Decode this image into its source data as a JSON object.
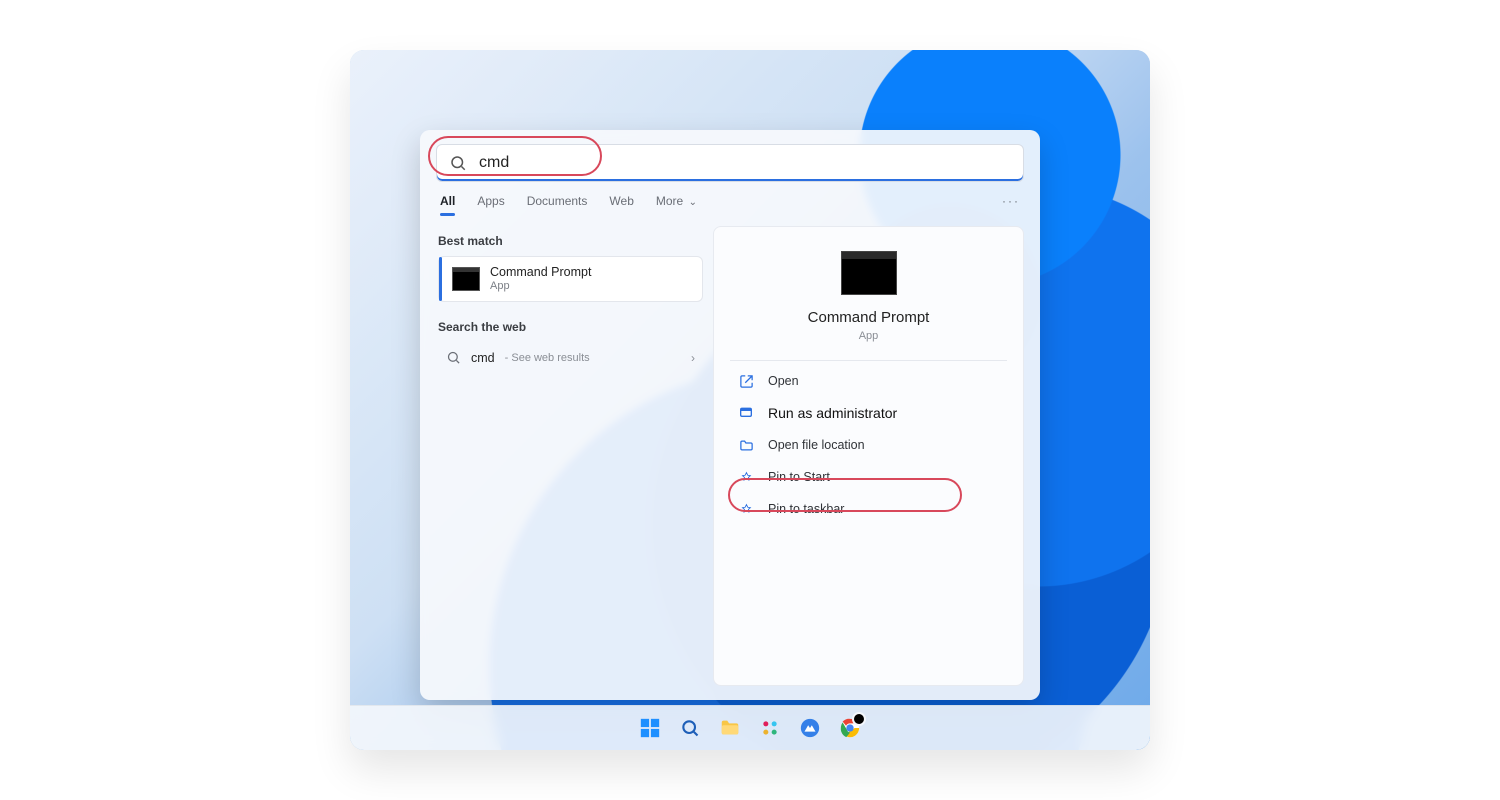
{
  "search": {
    "query": "cmd",
    "tabs": [
      "All",
      "Apps",
      "Documents",
      "Web",
      "More"
    ]
  },
  "left": {
    "best_match_heading": "Best match",
    "best_match": {
      "title": "Command Prompt",
      "subtitle": "App"
    },
    "web_heading": "Search the web",
    "web_item": {
      "query": "cmd",
      "hint": "See web results"
    }
  },
  "preview": {
    "title": "Command Prompt",
    "subtitle": "App",
    "actions": [
      {
        "key": "open",
        "label": "Open",
        "emph": false
      },
      {
        "key": "run-admin",
        "label": "Run as administrator",
        "emph": true
      },
      {
        "key": "open-loc",
        "label": "Open file location",
        "emph": false
      },
      {
        "key": "pin-start",
        "label": "Pin to Start",
        "emph": false
      },
      {
        "key": "pin-taskbar",
        "label": "Pin to taskbar",
        "emph": false
      }
    ]
  },
  "taskbar": [
    "start",
    "search",
    "explorer",
    "slack",
    "nordvpn",
    "chrome"
  ]
}
